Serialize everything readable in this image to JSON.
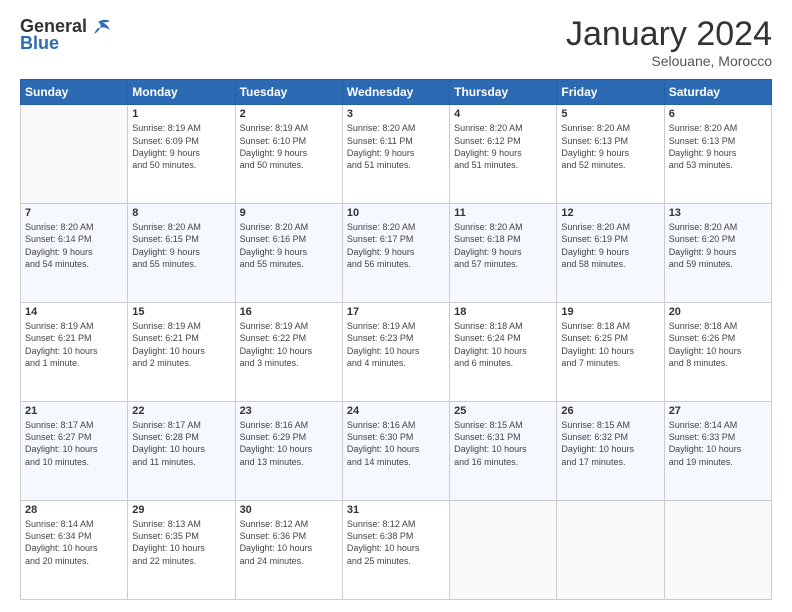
{
  "header": {
    "logo_general": "General",
    "logo_blue": "Blue",
    "title": "January 2024",
    "location": "Selouane, Morocco"
  },
  "weekdays": [
    "Sunday",
    "Monday",
    "Tuesday",
    "Wednesday",
    "Thursday",
    "Friday",
    "Saturday"
  ],
  "weeks": [
    [
      {
        "day": "",
        "info": ""
      },
      {
        "day": "1",
        "info": "Sunrise: 8:19 AM\nSunset: 6:09 PM\nDaylight: 9 hours\nand 50 minutes."
      },
      {
        "day": "2",
        "info": "Sunrise: 8:19 AM\nSunset: 6:10 PM\nDaylight: 9 hours\nand 50 minutes."
      },
      {
        "day": "3",
        "info": "Sunrise: 8:20 AM\nSunset: 6:11 PM\nDaylight: 9 hours\nand 51 minutes."
      },
      {
        "day": "4",
        "info": "Sunrise: 8:20 AM\nSunset: 6:12 PM\nDaylight: 9 hours\nand 51 minutes."
      },
      {
        "day": "5",
        "info": "Sunrise: 8:20 AM\nSunset: 6:13 PM\nDaylight: 9 hours\nand 52 minutes."
      },
      {
        "day": "6",
        "info": "Sunrise: 8:20 AM\nSunset: 6:13 PM\nDaylight: 9 hours\nand 53 minutes."
      }
    ],
    [
      {
        "day": "7",
        "info": "Sunrise: 8:20 AM\nSunset: 6:14 PM\nDaylight: 9 hours\nand 54 minutes."
      },
      {
        "day": "8",
        "info": "Sunrise: 8:20 AM\nSunset: 6:15 PM\nDaylight: 9 hours\nand 55 minutes."
      },
      {
        "day": "9",
        "info": "Sunrise: 8:20 AM\nSunset: 6:16 PM\nDaylight: 9 hours\nand 55 minutes."
      },
      {
        "day": "10",
        "info": "Sunrise: 8:20 AM\nSunset: 6:17 PM\nDaylight: 9 hours\nand 56 minutes."
      },
      {
        "day": "11",
        "info": "Sunrise: 8:20 AM\nSunset: 6:18 PM\nDaylight: 9 hours\nand 57 minutes."
      },
      {
        "day": "12",
        "info": "Sunrise: 8:20 AM\nSunset: 6:19 PM\nDaylight: 9 hours\nand 58 minutes."
      },
      {
        "day": "13",
        "info": "Sunrise: 8:20 AM\nSunset: 6:20 PM\nDaylight: 9 hours\nand 59 minutes."
      }
    ],
    [
      {
        "day": "14",
        "info": "Sunrise: 8:19 AM\nSunset: 6:21 PM\nDaylight: 10 hours\nand 1 minute."
      },
      {
        "day": "15",
        "info": "Sunrise: 8:19 AM\nSunset: 6:21 PM\nDaylight: 10 hours\nand 2 minutes."
      },
      {
        "day": "16",
        "info": "Sunrise: 8:19 AM\nSunset: 6:22 PM\nDaylight: 10 hours\nand 3 minutes."
      },
      {
        "day": "17",
        "info": "Sunrise: 8:19 AM\nSunset: 6:23 PM\nDaylight: 10 hours\nand 4 minutes."
      },
      {
        "day": "18",
        "info": "Sunrise: 8:18 AM\nSunset: 6:24 PM\nDaylight: 10 hours\nand 6 minutes."
      },
      {
        "day": "19",
        "info": "Sunrise: 8:18 AM\nSunset: 6:25 PM\nDaylight: 10 hours\nand 7 minutes."
      },
      {
        "day": "20",
        "info": "Sunrise: 8:18 AM\nSunset: 6:26 PM\nDaylight: 10 hours\nand 8 minutes."
      }
    ],
    [
      {
        "day": "21",
        "info": "Sunrise: 8:17 AM\nSunset: 6:27 PM\nDaylight: 10 hours\nand 10 minutes."
      },
      {
        "day": "22",
        "info": "Sunrise: 8:17 AM\nSunset: 6:28 PM\nDaylight: 10 hours\nand 11 minutes."
      },
      {
        "day": "23",
        "info": "Sunrise: 8:16 AM\nSunset: 6:29 PM\nDaylight: 10 hours\nand 13 minutes."
      },
      {
        "day": "24",
        "info": "Sunrise: 8:16 AM\nSunset: 6:30 PM\nDaylight: 10 hours\nand 14 minutes."
      },
      {
        "day": "25",
        "info": "Sunrise: 8:15 AM\nSunset: 6:31 PM\nDaylight: 10 hours\nand 16 minutes."
      },
      {
        "day": "26",
        "info": "Sunrise: 8:15 AM\nSunset: 6:32 PM\nDaylight: 10 hours\nand 17 minutes."
      },
      {
        "day": "27",
        "info": "Sunrise: 8:14 AM\nSunset: 6:33 PM\nDaylight: 10 hours\nand 19 minutes."
      }
    ],
    [
      {
        "day": "28",
        "info": "Sunrise: 8:14 AM\nSunset: 6:34 PM\nDaylight: 10 hours\nand 20 minutes."
      },
      {
        "day": "29",
        "info": "Sunrise: 8:13 AM\nSunset: 6:35 PM\nDaylight: 10 hours\nand 22 minutes."
      },
      {
        "day": "30",
        "info": "Sunrise: 8:12 AM\nSunset: 6:36 PM\nDaylight: 10 hours\nand 24 minutes."
      },
      {
        "day": "31",
        "info": "Sunrise: 8:12 AM\nSunset: 6:38 PM\nDaylight: 10 hours\nand 25 minutes."
      },
      {
        "day": "",
        "info": ""
      },
      {
        "day": "",
        "info": ""
      },
      {
        "day": "",
        "info": ""
      }
    ]
  ]
}
